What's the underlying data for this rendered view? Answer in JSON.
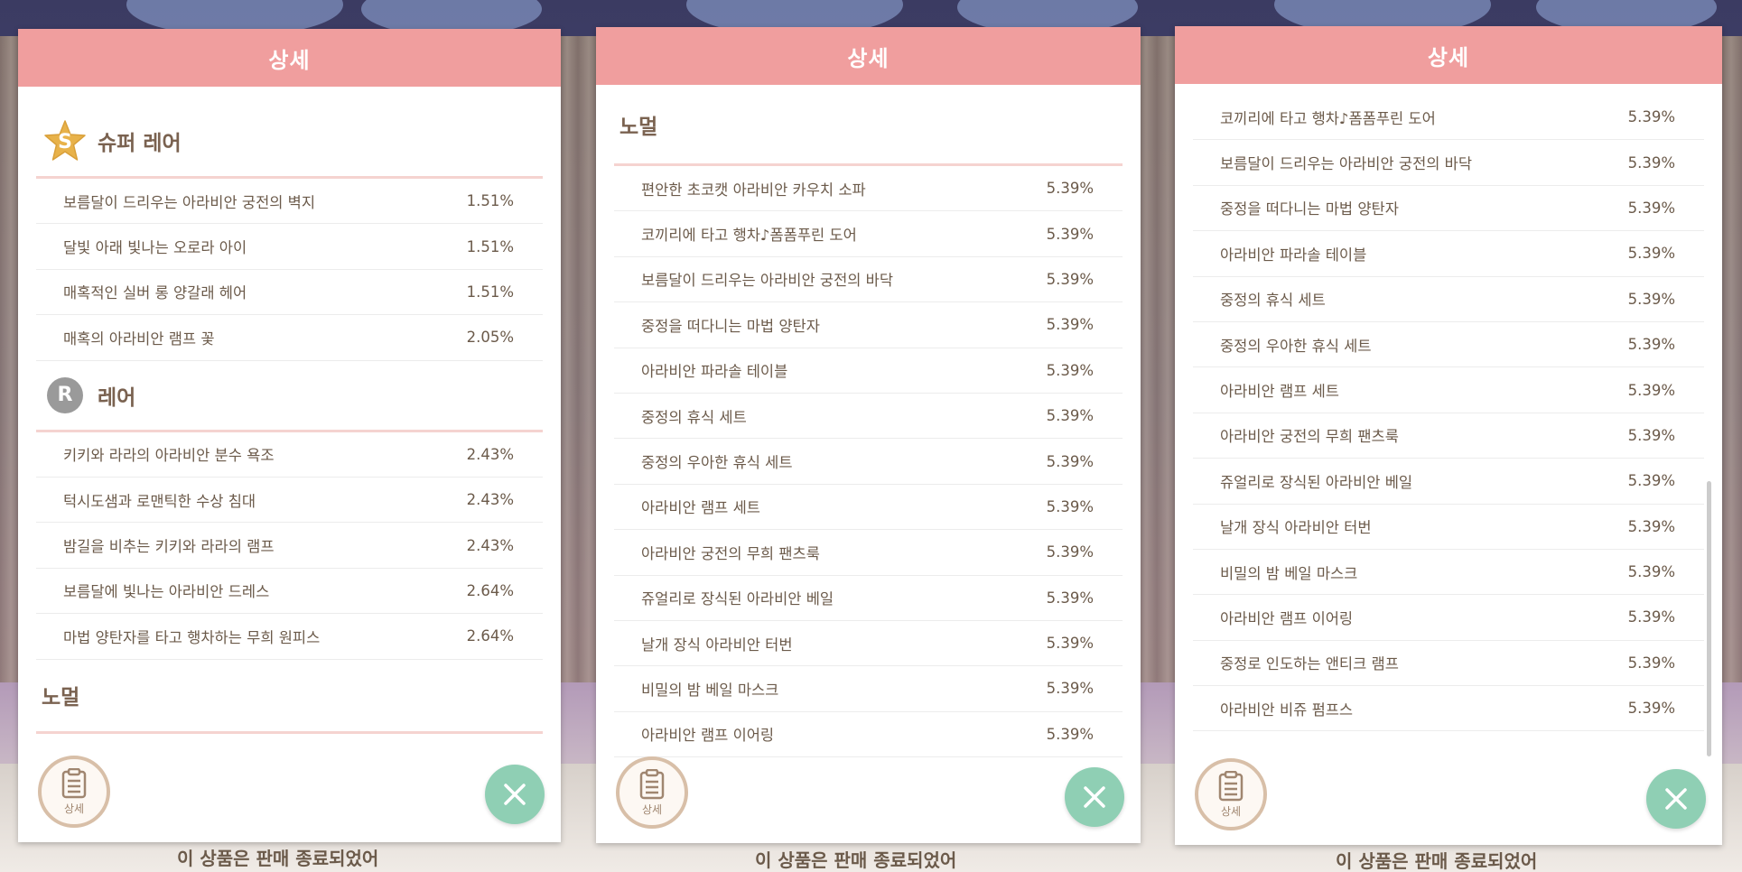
{
  "header_title": "상세",
  "detail_button_label": "상세",
  "footer_text": "이 상품은 판매 종료되었어",
  "screen1": {
    "super_rare": {
      "title": "슈퍼 레어",
      "icon_letter": "S",
      "items": [
        {
          "name": "보름달이 드리우는 아라비안 궁전의 벽지",
          "pct": "1.51%"
        },
        {
          "name": "달빛 아래 빛나는 오로라 아이",
          "pct": "1.51%"
        },
        {
          "name": "매혹적인 실버 롱 양갈래 헤어",
          "pct": "1.51%"
        },
        {
          "name": "매혹의 아라비안 램프 꽃",
          "pct": "2.05%"
        }
      ]
    },
    "rare": {
      "title": "레어",
      "icon_letter": "R",
      "items": [
        {
          "name": "키키와 라라의 아라비안 분수 욕조",
          "pct": "2.43%"
        },
        {
          "name": "턱시도샘과 로맨틱한 수상 침대",
          "pct": "2.43%"
        },
        {
          "name": "밤길을 비추는 키키와 라라의 램프",
          "pct": "2.43%"
        },
        {
          "name": "보름달에 빛나는 아라비안 드레스",
          "pct": "2.64%"
        },
        {
          "name": "마법 양탄자를 타고 행차하는 무희 원피스",
          "pct": "2.64%"
        }
      ]
    },
    "normal": {
      "title": "노멀"
    }
  },
  "screen2": {
    "normal": {
      "title": "노멀",
      "items": [
        {
          "name": "편안한 초코캣 아라비안 카우치 소파",
          "pct": "5.39%"
        },
        {
          "name": "코끼리에 타고 행차♪폼폼푸린 도어",
          "pct": "5.39%"
        },
        {
          "name": "보름달이 드리우는 아라비안 궁전의 바닥",
          "pct": "5.39%"
        },
        {
          "name": "중정을 떠다니는 마법 양탄자",
          "pct": "5.39%"
        },
        {
          "name": "아라비안 파라솔 테이블",
          "pct": "5.39%"
        },
        {
          "name": "중정의 휴식 세트",
          "pct": "5.39%"
        },
        {
          "name": "중정의 우아한 휴식 세트",
          "pct": "5.39%"
        },
        {
          "name": "아라비안 램프 세트",
          "pct": "5.39%"
        },
        {
          "name": "아라비안 궁전의 무희 팬츠룩",
          "pct": "5.39%"
        },
        {
          "name": "쥬얼리로 장식된 아라비안 베일",
          "pct": "5.39%"
        },
        {
          "name": "날개 장식 아라비안 터번",
          "pct": "5.39%"
        },
        {
          "name": "비밀의 밤 베일 마스크",
          "pct": "5.39%"
        },
        {
          "name": "아라비안 램프 이어링",
          "pct": "5.39%"
        }
      ]
    }
  },
  "screen3": {
    "items": [
      {
        "name": "코끼리에 타고 행차♪폼폼푸린 도어",
        "pct": "5.39%"
      },
      {
        "name": "보름달이 드리우는 아라비안 궁전의 바닥",
        "pct": "5.39%"
      },
      {
        "name": "중정을 떠다니는 마법 양탄자",
        "pct": "5.39%"
      },
      {
        "name": "아라비안 파라솔 테이블",
        "pct": "5.39%"
      },
      {
        "name": "중정의 휴식 세트",
        "pct": "5.39%"
      },
      {
        "name": "중정의 우아한 휴식 세트",
        "pct": "5.39%"
      },
      {
        "name": "아라비안 램프 세트",
        "pct": "5.39%"
      },
      {
        "name": "아라비안 궁전의 무희 팬츠룩",
        "pct": "5.39%"
      },
      {
        "name": "쥬얼리로 장식된 아라비안 베일",
        "pct": "5.39%"
      },
      {
        "name": "날개 장식 아라비안 터번",
        "pct": "5.39%"
      },
      {
        "name": "비밀의 밤 베일 마스크",
        "pct": "5.39%"
      },
      {
        "name": "아라비안 램프 이어링",
        "pct": "5.39%"
      },
      {
        "name": "중정로 인도하는 앤티크 램프",
        "pct": "5.39%"
      },
      {
        "name": "아라비안 비쥬 펌프스",
        "pct": "5.39%"
      }
    ]
  },
  "colors": {
    "header": "#f09e9e",
    "divider": "#f5d3d0",
    "text": "#6b5a4a",
    "star": "#e8b24a",
    "rare_badge": "#9a9a9a",
    "close_button": "#8fcfb4"
  }
}
